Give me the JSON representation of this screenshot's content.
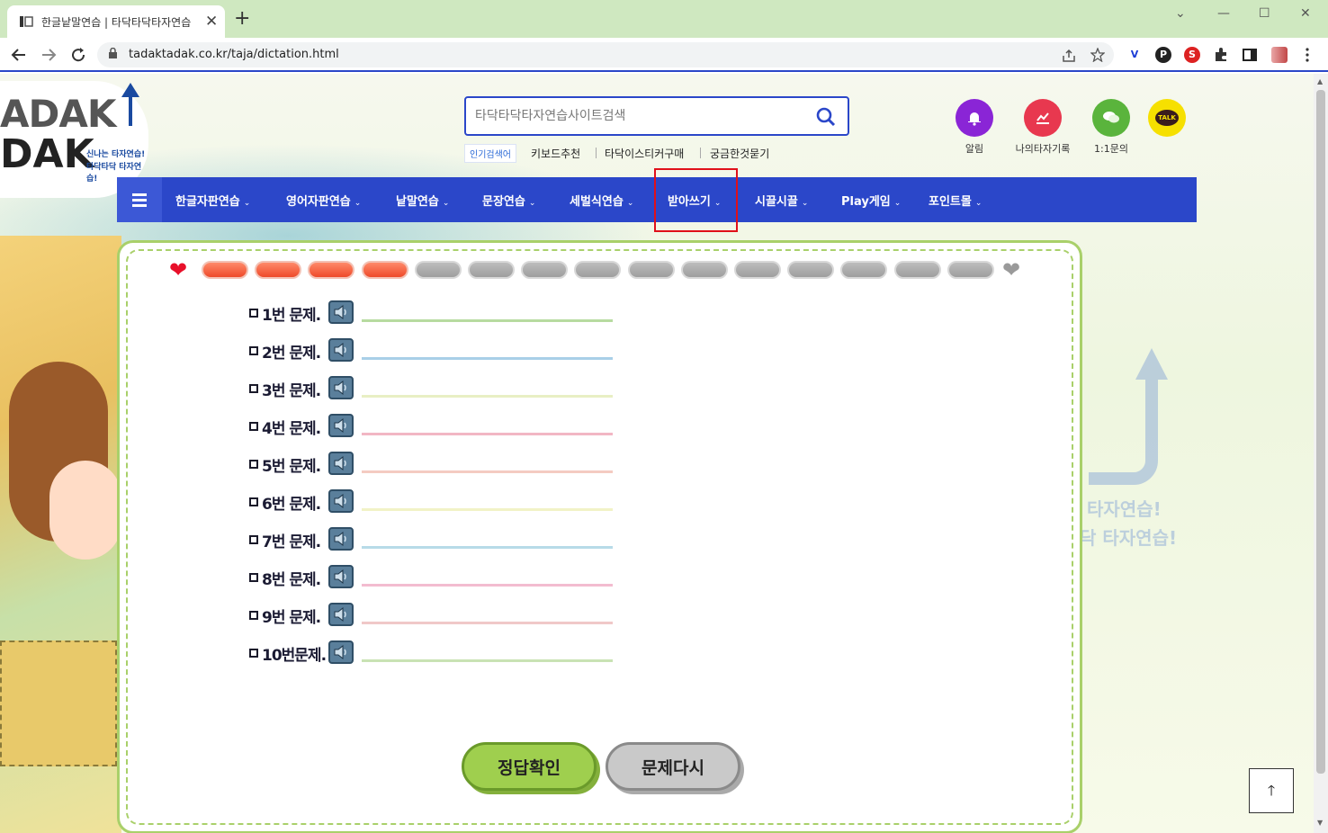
{
  "browser": {
    "tab_title": "한글낱말연습 | 타닥타닥타자연습",
    "url": "tadaktadak.co.kr/taja/dictation.html",
    "tab_close": "✕",
    "new_tab": "+",
    "window_buttons": [
      "⌄",
      "—",
      "☐",
      "✕"
    ]
  },
  "site": {
    "logo_line1": "ADAK",
    "logo_line2": "DAK",
    "logo_tagline1": "신나는 타자연습!",
    "logo_tagline2": "타닥타닥 타자연습!",
    "search_placeholder": "타닥타닥타자연습사이트검색",
    "popular_label": "인기검색어",
    "popular_keywords": [
      "키보드추천",
      "타닥이스티커구매",
      "궁금한것묻기"
    ],
    "quick_buttons": [
      {
        "label": "알림",
        "icon": "bell-icon",
        "color": "#8a25d6"
      },
      {
        "label": "나의타자기록",
        "icon": "chart-icon",
        "color": "#e8384f"
      },
      {
        "label": "1:1문의",
        "icon": "chat-icon",
        "color": "#5ab43c"
      },
      {
        "label": "",
        "icon": "kakao-talk-icon",
        "color": "#f6e000",
        "badge": "TALK"
      }
    ]
  },
  "gnb": {
    "items": [
      "한글자판연습",
      "영어자판연습",
      "낱말연습",
      "문장연습",
      "세벌식연습",
      "받아쓰기",
      "시끌시끌",
      "Play게임",
      "포인트몰"
    ],
    "active": "받아쓰기"
  },
  "dictation": {
    "progress_total": 15,
    "progress_done": 4,
    "questions": [
      {
        "label": "1번 문제.",
        "line_color": "#b7dba0"
      },
      {
        "label": "2번 문제.",
        "line_color": "#a9cfe8"
      },
      {
        "label": "3번 문제.",
        "line_color": "#e8efc4"
      },
      {
        "label": "4번 문제.",
        "line_color": "#f2b7c4"
      },
      {
        "label": "5번 문제.",
        "line_color": "#f4cbc2"
      },
      {
        "label": "6번 문제.",
        "line_color": "#f1f2c6"
      },
      {
        "label": "7번 문제.",
        "line_color": "#b7dbe8"
      },
      {
        "label": "8번 문제.",
        "line_color": "#f3bcd0"
      },
      {
        "label": "9번 문제.",
        "line_color": "#f0c8c8"
      },
      {
        "label": "10번문제.",
        "line_color": "#c9e2b4"
      }
    ],
    "check_button": "정답확인",
    "retry_button": "문제다시"
  },
  "colors": {
    "brand_blue": "#2b47c9",
    "board_green": "#a9d06a",
    "highlight_red": "#e0101a"
  },
  "to_top_icon": "arrow-up-icon",
  "to_top_glyph": "🡑"
}
